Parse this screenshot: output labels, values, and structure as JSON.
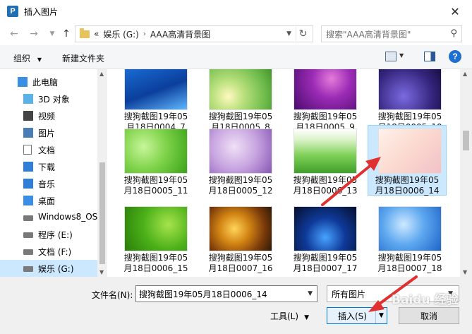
{
  "window": {
    "title": "插入图片",
    "app_icon_letter": "P"
  },
  "address": {
    "prefix": "«",
    "crumbs": [
      "娱乐 (G:)",
      "AAA高清背景图"
    ],
    "separator": "›"
  },
  "search": {
    "placeholder": "搜索\"AAA高清背景图\""
  },
  "toolbar": {
    "organize_label": "组织",
    "new_folder_label": "新建文件夹"
  },
  "sidebar": {
    "items": [
      {
        "label": "此电脑",
        "icon": "computer-icon"
      },
      {
        "label": "3D 对象",
        "icon": "cube-icon"
      },
      {
        "label": "视频",
        "icon": "video-icon"
      },
      {
        "label": "图片",
        "icon": "picture-icon"
      },
      {
        "label": "文档",
        "icon": "document-icon"
      },
      {
        "label": "下载",
        "icon": "download-icon"
      },
      {
        "label": "音乐",
        "icon": "music-icon"
      },
      {
        "label": "桌面",
        "icon": "desktop-icon"
      },
      {
        "label": "Windows8_OS",
        "icon": "drive-icon"
      },
      {
        "label": "程序 (E:)",
        "icon": "drive-icon"
      },
      {
        "label": "文档 (F:)",
        "icon": "drive-icon"
      },
      {
        "label": "娱乐 (G:)",
        "icon": "drive-icon"
      }
    ],
    "selected_index": 11
  },
  "files": {
    "rows": [
      [
        {
          "line1": "搜狗截图19年05",
          "line2": "月18日0004_7"
        },
        {
          "line1": "搜狗截图19年05",
          "line2": "月18日0005_8"
        },
        {
          "line1": "搜狗截图19年05",
          "line2": "月18日0005_9"
        },
        {
          "line1": "搜狗截图19年05",
          "line2": "月18日0005_10"
        }
      ],
      [
        {
          "line1": "搜狗截图19年05",
          "line2": "月18日0005_11"
        },
        {
          "line1": "搜狗截图19年05",
          "line2": "月18日0005_12"
        },
        {
          "line1": "搜狗截图19年05",
          "line2": "月18日0006_13"
        },
        {
          "line1": "搜狗截图19年05",
          "line2": "月18日0006_14"
        }
      ],
      [
        {
          "line1": "搜狗截图19年05",
          "line2": "月18日0006_15"
        },
        {
          "line1": "搜狗截图19年05",
          "line2": "月18日0007_16"
        },
        {
          "line1": "搜狗截图19年05",
          "line2": "月18日0007_17"
        },
        {
          "line1": "搜狗截图19年05",
          "line2": "月18日0007_18"
        }
      ]
    ],
    "selected": "月18日0006_14"
  },
  "bottom": {
    "filename_label": "文件名(N):",
    "filename_value": "搜狗截图19年05月18日0006_14",
    "filter_value": "所有图片",
    "tools_label": "工具(L)",
    "insert_label": "插入(S)",
    "cancel_label": "取消"
  },
  "watermark": "Baidu 经验",
  "colors": {
    "selection": "#cce8ff",
    "accent": "#0078d7",
    "annotation_arrow": "#e0302f"
  }
}
